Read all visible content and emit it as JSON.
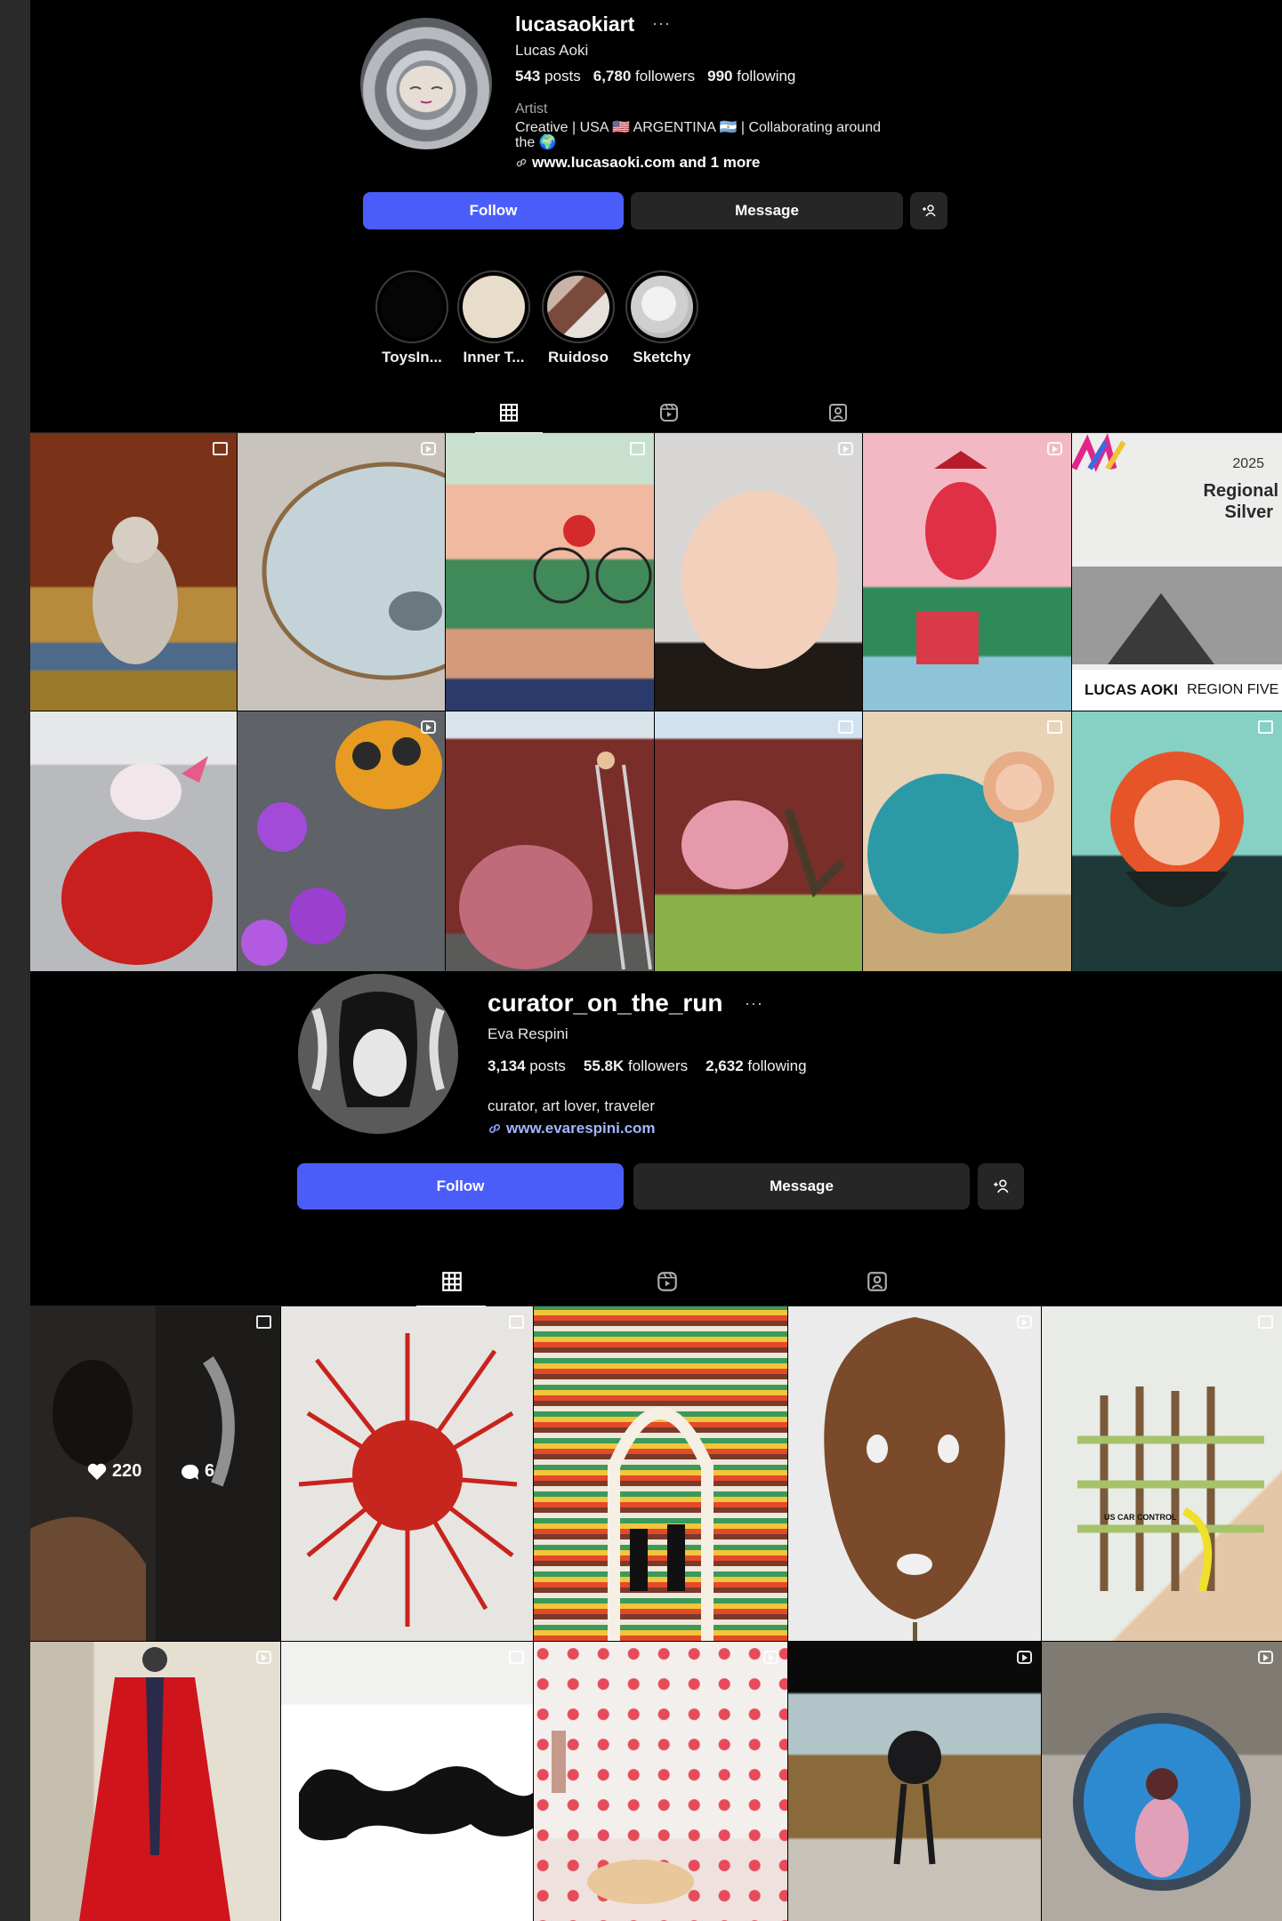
{
  "profile1": {
    "username": "lucasaokiart",
    "more": "···",
    "full_name": "Lucas Aoki",
    "stats": {
      "posts_value": "543",
      "posts_label": "posts",
      "followers_value": "6,780",
      "followers_label": "followers",
      "following_value": "990",
      "following_label": "following"
    },
    "category": "Artist",
    "bio_line1": "Creative | USA 🇺🇸 ARGENTINA 🇦🇷 | Collaborating around",
    "bio_line2": "the 🌍",
    "link": "www.lucasaoki.com and 1 more",
    "follow_label": "Follow",
    "message_label": "Message",
    "highlights": [
      {
        "label": "ToysIn...",
        "color": "#050505"
      },
      {
        "label": "Inner T...",
        "color": "#e8dccb"
      },
      {
        "label": "Ruidoso",
        "color": "#b08a7a"
      },
      {
        "label": "Sketchy",
        "color": "#d9d9d9"
      }
    ],
    "grid_tiles": [
      {
        "name": "tile-sculpture-forest",
        "badge": "multi"
      },
      {
        "name": "tile-mirror",
        "badge": "play"
      },
      {
        "name": "tile-mural-bicycle",
        "badge": "multi"
      },
      {
        "name": "tile-soft-sculpture",
        "badge": "play"
      },
      {
        "name": "tile-painting-red-rider",
        "badge": "play"
      },
      {
        "name": "tile-award-region-five",
        "badge": "none"
      },
      {
        "name": "tile-mural-red-creature",
        "badge": "none"
      },
      {
        "name": "tile-mural-bee",
        "badge": "play"
      },
      {
        "name": "tile-mural-barn-ladder",
        "badge": "none"
      },
      {
        "name": "tile-mural-barn-deer",
        "badge": "multi"
      },
      {
        "name": "tile-mural-blue-creature",
        "badge": "multi"
      },
      {
        "name": "tile-mural-sun-face",
        "badge": "multi"
      }
    ],
    "award_text": {
      "year": "2025",
      "line1": "Regional",
      "line2": "Silver",
      "footer_left": "LUCAS AOKI",
      "footer_right": "REGION FIVE"
    }
  },
  "profile2": {
    "username": "curator_on_the_run",
    "more": "···",
    "full_name": "Eva Respini",
    "stats": {
      "posts_value": "3,134",
      "posts_label": "posts",
      "followers_value": "55.8K",
      "followers_label": "followers",
      "following_value": "2,632",
      "following_label": "following"
    },
    "bio": "curator, art lover, traveler",
    "link": "www.evarespini.com",
    "follow_label": "Follow",
    "message_label": "Message",
    "grid_tiles": [
      {
        "name": "tile-photo-figures",
        "badge": "multi"
      },
      {
        "name": "tile-red-spike-mask",
        "badge": "multi"
      },
      {
        "name": "tile-striped-room",
        "badge": "none"
      },
      {
        "name": "tile-wooden-mask",
        "badge": "play"
      },
      {
        "name": "tile-woven-sticks",
        "badge": "multi"
      },
      {
        "name": "tile-red-robe",
        "badge": "play"
      },
      {
        "name": "tile-black-ink-shape",
        "badge": "multi"
      },
      {
        "name": "tile-polka-dot-room",
        "badge": "play"
      },
      {
        "name": "tile-sphere-sculpture",
        "badge": "play"
      },
      {
        "name": "tile-round-portal",
        "badge": "play"
      }
    ],
    "hover_overlay": {
      "likes": "220",
      "comments": "6"
    },
    "tape_text": "US CAR  CONTROL"
  },
  "colors": {
    "follow_blue": "#4a5df9",
    "button_dark": "#262626",
    "background": "#000000"
  }
}
